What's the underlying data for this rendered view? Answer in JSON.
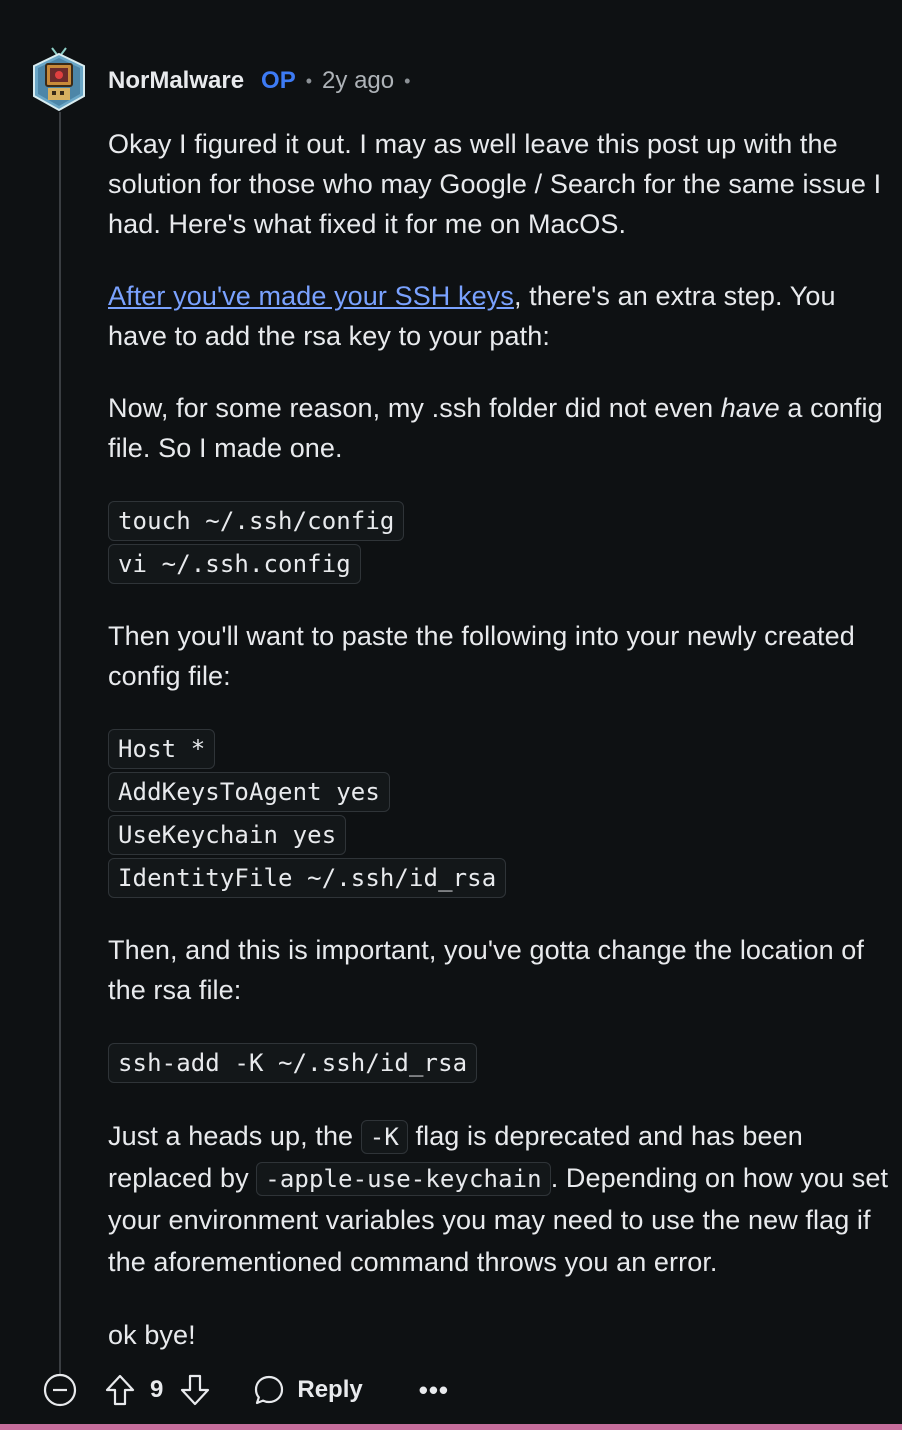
{
  "comment": {
    "author": "NorMalware",
    "op_badge": "OP",
    "separator": "•",
    "age": "2y ago",
    "trailing_separator": "•",
    "paragraph1": "Okay I figured it out. I may as well leave this post up with the solution for those who may Google / Search for the same issue I had. Here's what fixed it for me on MacOS.",
    "link_text": "After you've made your SSH keys",
    "paragraph2_rest": ", there's an extra step. You have to add the rsa key to your path:",
    "paragraph3_start": "Now, for some reason, my .ssh folder did not even ",
    "paragraph3_em": "have",
    "paragraph3_end": " a config file. So I made one.",
    "code1": [
      "touch ~/.ssh/config",
      "vi ~/.ssh.config"
    ],
    "paragraph4": "Then you'll want to paste the following into your newly created config file:",
    "code2": [
      "Host *",
      "AddKeysToAgent yes",
      "UseKeychain yes",
      "IdentityFile ~/.ssh/id_rsa"
    ],
    "paragraph5": "Then, and this is important, you've gotta change the location of the rsa file:",
    "code3": [
      "ssh-add -K ~/.ssh/id_rsa"
    ],
    "paragraph6_a": "Just a heads up, the ",
    "paragraph6_code1": "-K",
    "paragraph6_b": " flag is deprecated and has been replaced by ",
    "paragraph6_code2": "-apple-use-keychain",
    "paragraph6_c": ". Depending on how you set your environment variables you may need to use the new flag if the aforementioned command throws you an error.",
    "paragraph7": "ok bye!"
  },
  "actions": {
    "score": "9",
    "reply_label": "Reply",
    "more_label": "•••",
    "collapse_icon": "minus-circle-icon",
    "upvote_icon": "arrow-up-icon",
    "downvote_icon": "arrow-down-icon",
    "reply_icon": "speech-bubble-icon"
  },
  "colors": {
    "background": "#0e1113",
    "op_badge": "#3d7bf5",
    "link": "#7aa2ff",
    "bottom_accent": "#c86f9d"
  }
}
